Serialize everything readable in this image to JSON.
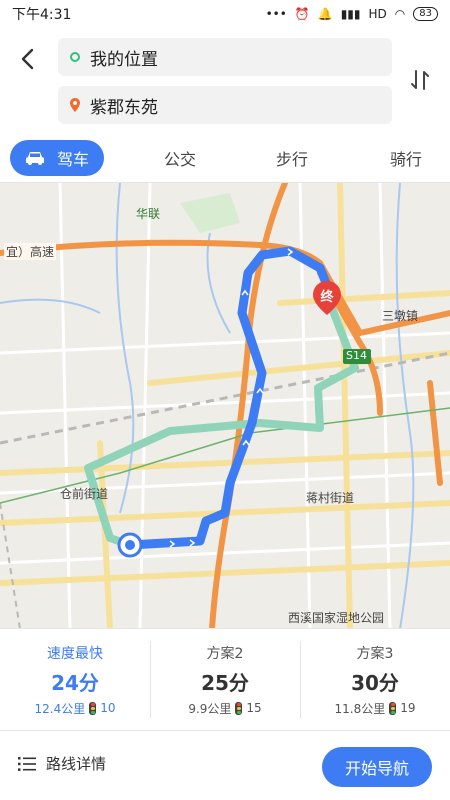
{
  "status_bar": {
    "time": "下午4:31",
    "icons": [
      "more-icon",
      "alarm-icon",
      "bell-icon",
      "signal-icon",
      "wifi-icon"
    ],
    "network": "HD",
    "battery": "83"
  },
  "search": {
    "origin": "我的位置",
    "destination": "紫郡东苑"
  },
  "tabs": [
    {
      "label": "驾车",
      "icon": "car-icon",
      "active": true
    },
    {
      "label": "公交",
      "active": false
    },
    {
      "label": "步行",
      "active": false
    },
    {
      "label": "骑行",
      "active": false
    }
  ],
  "map": {
    "labels": {
      "hualian": "华联",
      "highway": "宜）高速",
      "sandun": "三墩镇",
      "s14": "S14",
      "cangqian": "仓前街道",
      "jiangcun": "蒋村街道",
      "xixi": "西溪国家湿地公园"
    },
    "end_marker": "终",
    "colors": {
      "route_main": "#3d7cf2",
      "route_alt": "#8fd3b9",
      "highway": "#f29446",
      "road_yellow": "#f7e19a"
    }
  },
  "plans": [
    {
      "name": "速度最快",
      "time": "24分",
      "distance": "12.4公里",
      "lights": "10",
      "selected": true
    },
    {
      "name": "方案2",
      "time": "25分",
      "distance": "9.9公里",
      "lights": "15",
      "selected": false
    },
    {
      "name": "方案3",
      "time": "30分",
      "distance": "11.8公里",
      "lights": "19",
      "selected": false
    }
  ],
  "bottom": {
    "details_label": "路线详情",
    "start_label": "开始导航"
  }
}
